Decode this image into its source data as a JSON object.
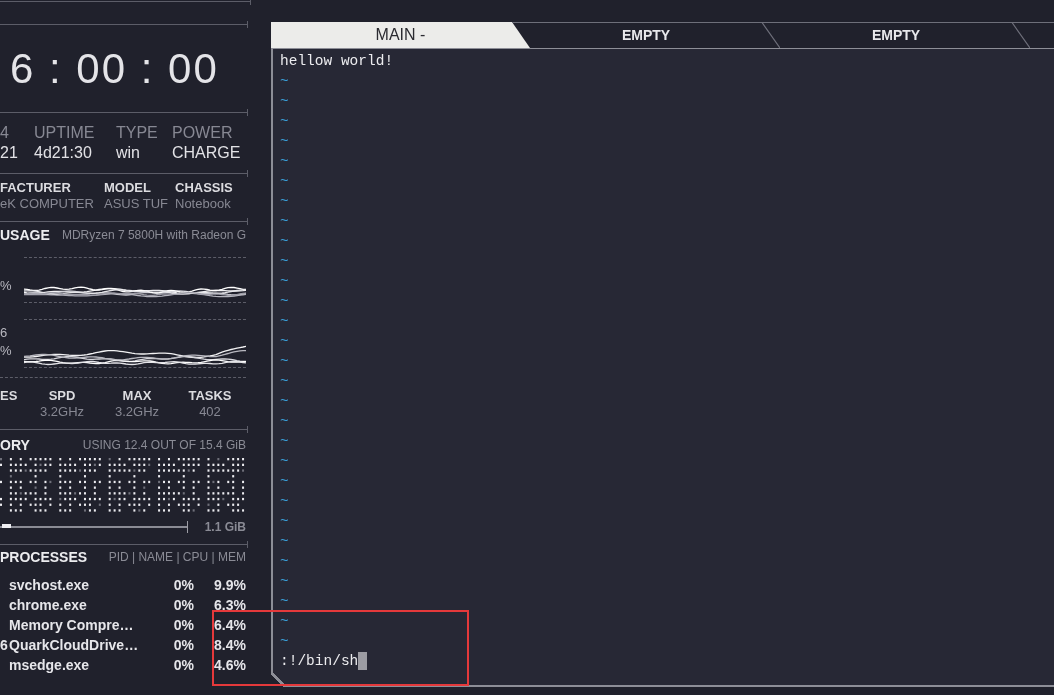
{
  "clock": {
    "time": "6 : 00 : 00"
  },
  "system_info": [
    {
      "heading": "4",
      "value": "21"
    },
    {
      "heading": "UPTIME",
      "value": "4d21:30"
    },
    {
      "heading": "TYPE",
      "value": "win"
    },
    {
      "heading": "POWER",
      "value": "CHARGE"
    }
  ],
  "hardware_info": [
    {
      "heading": "FACTURER",
      "value": "eK COMPUTER"
    },
    {
      "heading": "MODEL",
      "value": "ASUS TUF"
    },
    {
      "heading": "CHASSIS",
      "value": "Notebook"
    }
  ],
  "cpu": {
    "title": "USAGE",
    "model": "MDRyzen 7 5800H with Radeon G",
    "graphs": [
      {
        "labels": [
          "%"
        ]
      },
      {
        "labels": [
          "6",
          "%"
        ]
      }
    ],
    "stats": [
      {
        "heading": "ES"
      },
      {
        "heading": "SPD",
        "value": "3.2GHz"
      },
      {
        "heading": "MAX",
        "value": "3.2GHz"
      },
      {
        "heading": "TASKS",
        "value": "402"
      }
    ]
  },
  "memory": {
    "title": "ORY",
    "usage": "USING 12.4 OUT OF 15.4 GiB",
    "swap": {
      "level": 0.05,
      "reading": "1.1 GiB"
    }
  },
  "processes": {
    "title": "PROCESSES",
    "columns": "PID | NAME | CPU | MEM",
    "rows": [
      {
        "name": "svchost.exe",
        "cpu": "0%",
        "mem": "9.9%"
      },
      {
        "name": "chrome.exe",
        "cpu": "0%",
        "mem": "6.3%"
      },
      {
        "name": "Memory Compre…",
        "cpu": "0%",
        "mem": "6.4%"
      },
      {
        "pid": "6",
        "name": "QuarkCloudDrive…",
        "cpu": "0%",
        "mem": "8.4%"
      },
      {
        "name": "msedge.exe",
        "cpu": "0%",
        "mem": "4.6%"
      }
    ]
  },
  "terminal": {
    "tabs": [
      {
        "label": "MAIN -",
        "selected": true
      },
      {
        "label": "EMPTY",
        "selected": false
      },
      {
        "label": "EMPTY",
        "selected": false
      }
    ],
    "lines": [
      "hellow world!"
    ],
    "empty_line_markers": [
      "~",
      "~",
      "~",
      "~",
      "~",
      "~",
      "~",
      "~",
      "~",
      "~",
      "~",
      "~",
      "~",
      "~",
      "~",
      "~",
      "~",
      "~",
      "~",
      "~",
      "~",
      "~",
      "~",
      "~",
      "~",
      "~",
      "~",
      "~",
      "~"
    ],
    "command_line": {
      "text": ":!/bin/sh",
      "cursor": true
    }
  },
  "annotation": {
    "kind": "rectangle"
  }
}
